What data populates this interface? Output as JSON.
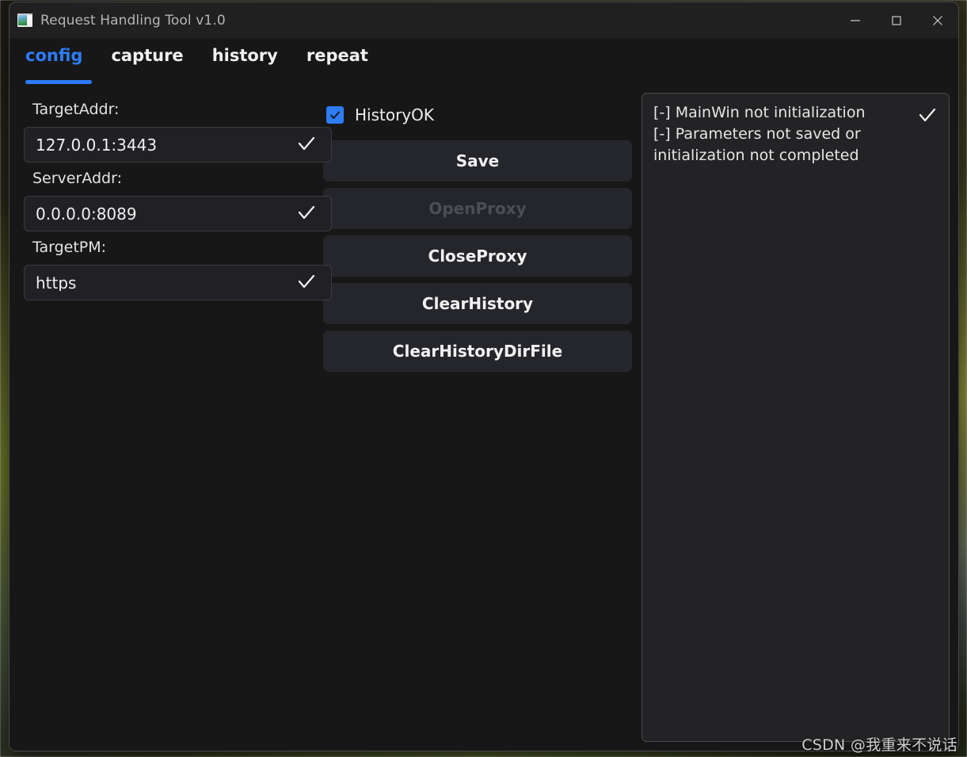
{
  "window": {
    "title": "Request Handling Tool v1.0",
    "icon": "app-window-icon",
    "minimize_label": "–",
    "maximize_label": "☐",
    "close_label": "✕"
  },
  "tabs": [
    {
      "label": "config",
      "active": true
    },
    {
      "label": "capture",
      "active": false
    },
    {
      "label": "history",
      "active": false
    },
    {
      "label": "repeat",
      "active": false
    }
  ],
  "fields": [
    {
      "label": "TargetAddr:",
      "value": "127.0.0.1:3443",
      "confirm_icon": "check-icon"
    },
    {
      "label": "ServerAddr:",
      "value": "0.0.0.0:8089",
      "confirm_icon": "check-icon"
    },
    {
      "label": "TargetPM:",
      "value": "https",
      "confirm_icon": "check-icon"
    }
  ],
  "options": {
    "history_ok": {
      "label": "HistoryOK",
      "checked": true
    }
  },
  "buttons": [
    {
      "label": "Save",
      "disabled": false
    },
    {
      "label": "OpenProxy",
      "disabled": true
    },
    {
      "label": "CloseProxy",
      "disabled": false
    },
    {
      "label": "ClearHistory",
      "disabled": false
    },
    {
      "label": "ClearHistoryDirFile",
      "disabled": false
    }
  ],
  "log": {
    "entries": [
      "[-] MainWin not initialization",
      "[-] Parameters not saved or initialization not completed"
    ],
    "status_icon": "check-icon"
  },
  "watermark": "CSDN @我重来不说话",
  "colors": {
    "accent": "#2e7cf6",
    "window_bg": "#171717",
    "titlebar_bg": "#202020",
    "button_bg": "#25262c",
    "field_bg": "#212125",
    "log_bg": "#232326",
    "text": "#efefef",
    "text_disabled": "#4d4e54"
  }
}
